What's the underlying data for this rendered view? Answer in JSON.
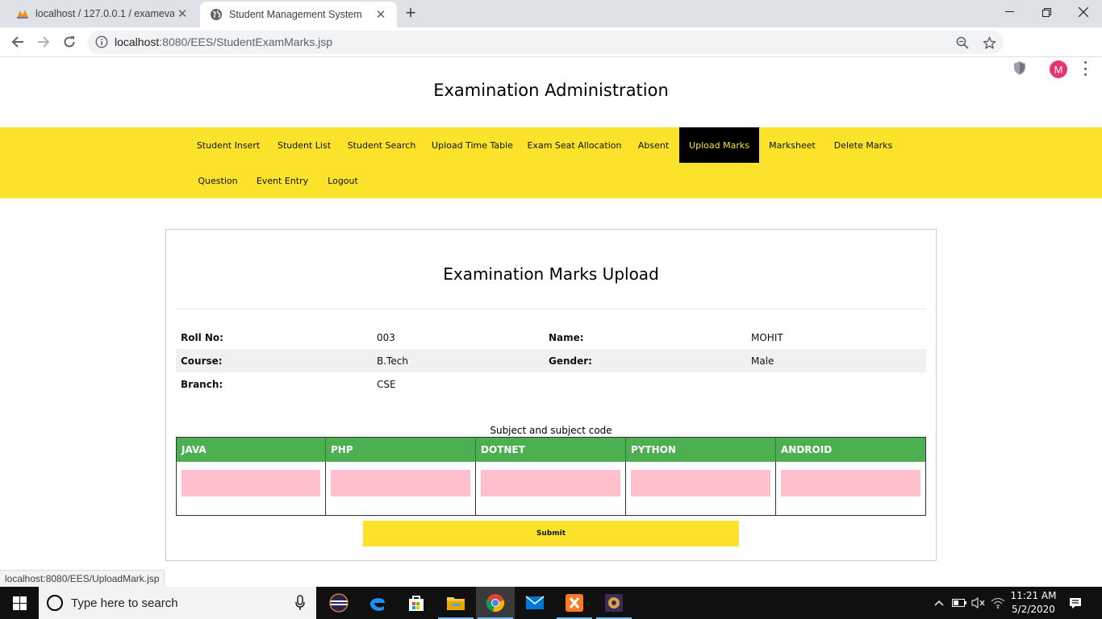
{
  "browser": {
    "tabs": [
      {
        "title": "localhost / 127.0.0.1 / examevalu",
        "icon": "phpmyadmin-icon"
      },
      {
        "title": "Student Management System",
        "icon": "globe-icon"
      }
    ],
    "url_host": "localhost",
    "url_path": ":8080/EES/StudentExamMarks.jsp",
    "profile_initial": "M",
    "status_url": "localhost:8080/EES/UploadMark.jsp"
  },
  "site": {
    "title": "Examination Administration",
    "nav": [
      {
        "label": "Student Insert"
      },
      {
        "label": "Student List"
      },
      {
        "label": "Student Search"
      },
      {
        "label": "Upload Time Table"
      },
      {
        "label": "Exam Seat Allocation"
      },
      {
        "label": "Absent"
      },
      {
        "label": "Upload Marks",
        "active": true
      },
      {
        "label": "Marksheet"
      },
      {
        "label": "Delete Marks"
      },
      {
        "label": "Question"
      },
      {
        "label": "Event Entry"
      },
      {
        "label": "Logout"
      }
    ]
  },
  "form": {
    "title": "Examination Marks Upload",
    "student": {
      "roll_label": "Roll No:",
      "roll": "003",
      "name_label": "Name:",
      "name": "MOHIT",
      "course_label": "Course:",
      "course": "B.Tech",
      "gender_label": "Gender:",
      "gender": "Male",
      "branch_label": "Branch:",
      "branch": "CSE"
    },
    "subjects_caption": "Subject and subject code",
    "subjects": [
      "JAVA",
      "PHP",
      "DOTNET",
      "PYTHON",
      "ANDROID"
    ],
    "marks": [
      "",
      "",
      "",
      "",
      ""
    ],
    "submit_label": "Submit",
    "colors": {
      "nav_bg": "#fbe32b",
      "active_nav_bg": "#000000",
      "header_green": "#4caf50",
      "input_pink": "#ffc0cb"
    }
  },
  "taskbar": {
    "search_placeholder": "Type here to search",
    "time": "11:21 AM",
    "date": "5/2/2020"
  }
}
